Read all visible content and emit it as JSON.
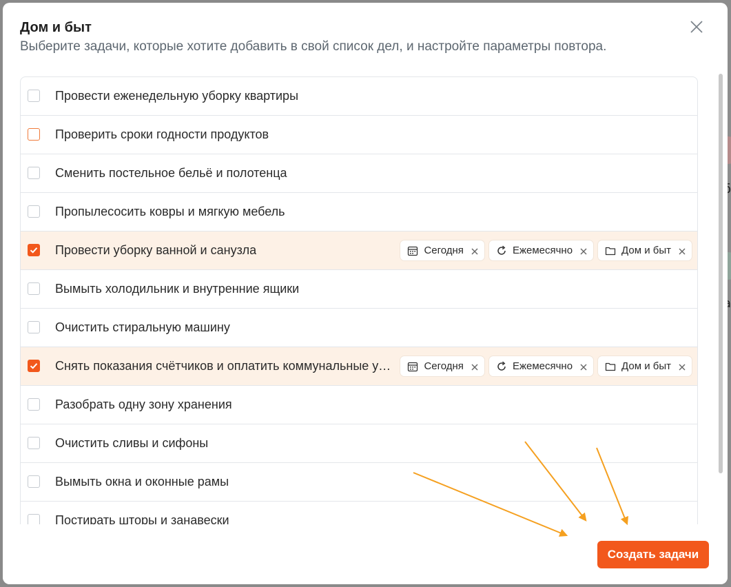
{
  "modal": {
    "title": "Дом и быт",
    "subtitle": "Выберите задачи, которые хотите добавить в свой список дел, и настройте параметры повтора."
  },
  "tasks": [
    {
      "label": "Провести еженедельную уборку квартиры",
      "checked": false
    },
    {
      "label": "Проверить сроки годности продуктов",
      "checked": false,
      "focused": true
    },
    {
      "label": "Сменить постельное бельё и полотенца",
      "checked": false
    },
    {
      "label": "Пропылесосить ковры и мягкую мебель",
      "checked": false
    },
    {
      "label": "Провести уборку ванной и санузла",
      "checked": true,
      "chips": {
        "date": "Сегодня",
        "repeat": "Ежемесячно",
        "project": "Дом и быт"
      }
    },
    {
      "label": "Вымыть холодильник и внутренние ящики",
      "checked": false
    },
    {
      "label": "Очистить стиральную машину",
      "checked": false
    },
    {
      "label": "Снять показания счётчиков и оплатить коммунальные ус...",
      "checked": true,
      "chips": {
        "date": "Сегодня",
        "repeat": "Ежемесячно",
        "project": "Дом и быт"
      }
    },
    {
      "label": "Разобрать одну зону хранения",
      "checked": false
    },
    {
      "label": "Очистить сливы и сифоны",
      "checked": false
    },
    {
      "label": "Вымыть окна и оконные рамы",
      "checked": false
    },
    {
      "label": "Постирать шторы и занавески",
      "checked": false
    }
  ],
  "footer": {
    "create_label": "Создать задачи"
  },
  "background": {
    "char1": "б",
    "char2": "а"
  },
  "colors": {
    "accent": "#f2581c",
    "selected_row": "#fdf1e6",
    "arrow": "#f5a020"
  },
  "icons": {
    "close": "close-icon",
    "date": "calendar-icon",
    "repeat": "repeat-icon",
    "project": "folder-icon",
    "remove": "x-icon",
    "check": "checkmark-icon"
  }
}
